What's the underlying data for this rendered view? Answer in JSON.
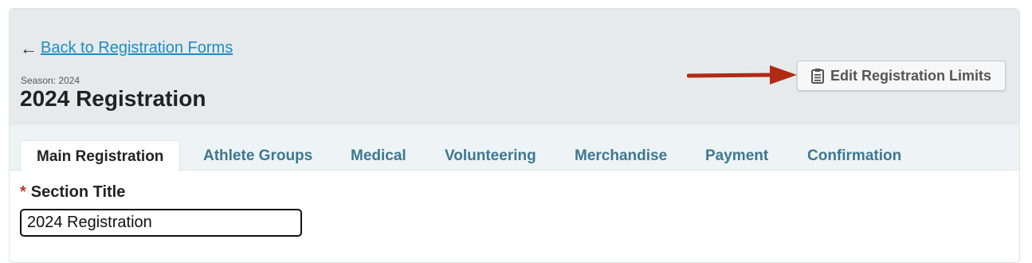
{
  "header": {
    "back_arrow": "←",
    "back_link": "Back to Registration Forms",
    "season_label": "Season: 2024",
    "form_title": "2024 Registration",
    "edit_limits_button": "Edit Registration Limits",
    "edit_limits_icon": "clipboard-icon",
    "annotation_color": "#b02a14"
  },
  "tabs": [
    {
      "label": "Main Registration",
      "active": true
    },
    {
      "label": "Athlete Groups",
      "active": false
    },
    {
      "label": "Medical",
      "active": false
    },
    {
      "label": "Volunteering",
      "active": false
    },
    {
      "label": "Merchandise",
      "active": false
    },
    {
      "label": "Payment",
      "active": false
    },
    {
      "label": "Confirmation",
      "active": false
    }
  ],
  "form": {
    "required_marker": "*",
    "section_title_label": "Section Title",
    "section_title_value": "2024 Registration"
  }
}
